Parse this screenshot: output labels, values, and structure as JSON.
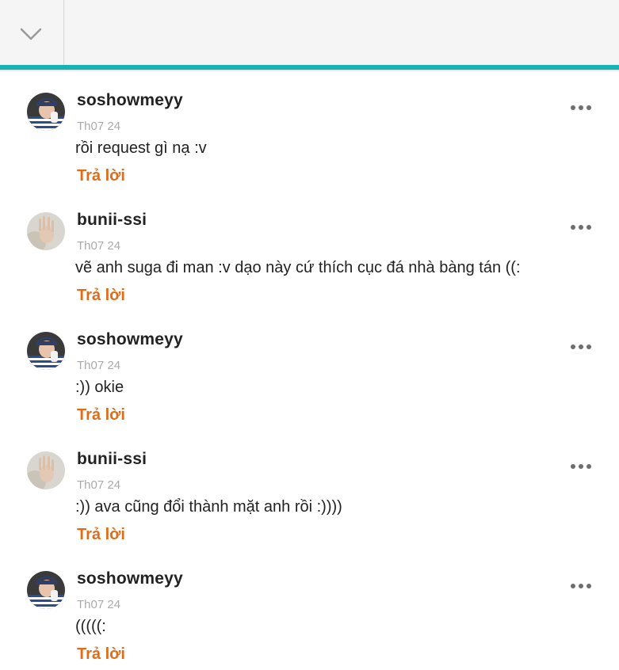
{
  "header": {
    "collapse_icon": "chevron-down-icon",
    "accent_color": "#16b3b3"
  },
  "reply_color": "#e06c19",
  "comments": [
    {
      "username": "soshowmeyy",
      "date": "Th07 24",
      "text": "rồi request gì nạ :v",
      "reply_label": "Trả lời",
      "avatar": "avatar-soshowmeyy"
    },
    {
      "username": "bunii-ssi",
      "date": "Th07 24",
      "text": "vẽ anh suga đi man :v dạo này cứ thích cục đá nhà bàng tán ((:",
      "reply_label": "Trả lời",
      "avatar": "avatar-bunii-ssi"
    },
    {
      "username": "soshowmeyy",
      "date": "Th07 24",
      "text": ":)) okie",
      "reply_label": "Trả lời",
      "avatar": "avatar-soshowmeyy"
    },
    {
      "username": "bunii-ssi",
      "date": "Th07 24",
      "text": ":)) ava cũng đổi thành mặt anh rồi :))))",
      "reply_label": "Trả lời",
      "avatar": "avatar-bunii-ssi"
    },
    {
      "username": "soshowmeyy",
      "date": "Th07 24",
      "text": "(((((:",
      "reply_label": "Trả lời",
      "avatar": "avatar-soshowmeyy"
    }
  ]
}
